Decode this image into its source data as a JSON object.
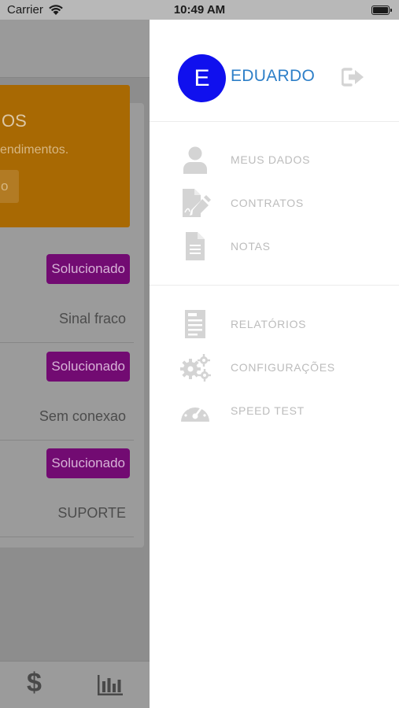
{
  "status_bar": {
    "carrier": "Carrier",
    "time": "10:49 AM"
  },
  "background": {
    "banner": {
      "title": "OS",
      "text": "endimentos.",
      "button": "o"
    },
    "tickets": [
      {
        "status": "Solucionado",
        "title": "Sinal fraco"
      },
      {
        "status": "Solucionado",
        "title": "Sem conexao"
      },
      {
        "status": "Solucionado",
        "title": "SUPORTE"
      }
    ],
    "tabbar": {
      "dollar": "$"
    }
  },
  "drawer": {
    "avatar_initial": "E",
    "user_name": "EDUARDO",
    "menu_primary": [
      {
        "label": "MEUS DADOS",
        "icon": "user-icon"
      },
      {
        "label": "CONTRATOS",
        "icon": "contract-icon"
      },
      {
        "label": "NOTAS",
        "icon": "document-icon"
      }
    ],
    "menu_secondary": [
      {
        "label": "RELATÓRIOS",
        "icon": "report-icon"
      },
      {
        "label": "CONFIGURAÇÕES",
        "icon": "gears-icon"
      },
      {
        "label": "SPEED TEST",
        "icon": "speedometer-icon"
      }
    ]
  },
  "colors": {
    "avatar": "#1010ee",
    "user_name": "#2d7fc8",
    "menu_text": "#bcbcbc",
    "menu_icon": "#d4d4d4",
    "badge": "#720b72",
    "banner": "#a86903"
  }
}
